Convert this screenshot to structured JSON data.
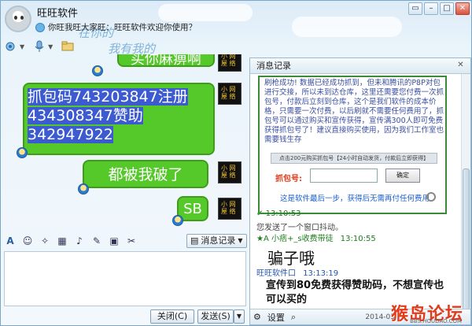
{
  "window": {
    "title": "旺旺软件",
    "status": "你旺我旺大家旺：旺旺软件欢迎你使用？",
    "decor_text": [
      "在你的",
      "我有我的"
    ]
  },
  "window_buttons": [
    "▭",
    "–",
    "□",
    "✕"
  ],
  "chat": {
    "messages": [
      {
        "text": "买你麻痹啊"
      },
      {
        "text": "抓包码743203847注册434308347赞助342947922"
      },
      {
        "text": "都被我破了"
      },
      {
        "text": "SB"
      }
    ],
    "sender_icon_label": "小 网 屋 络"
  },
  "input_toolbar": {
    "history_label": "消息记录"
  },
  "buttons": {
    "close_label": "关闭(C)",
    "send_label": "发送(S)"
  },
  "panel": {
    "title": "消息记录",
    "ad_text": "刷枪成功! 数据已经成功抓到，但未和腾讯的P8P对包进行交接，所以未到达仓库，这里还需要您付费一次抓包号，付款后立刻到仓库，这个是我们软件的成本价格，只需要一次付费，以后刷就不需要任何费用了，抓包号可以通过购买和宣传获得，宣传满300人即可免费获得抓包号了！建议直接购买使用，因为我们工作室也需要钱生存",
    "ad_bar_text": "点击200元购买抓包号【24小时自动发货，付款后立即获得】",
    "ad_label": "抓包号:",
    "ad_ok": "确定",
    "ad_foot": "这是软件最后一步，获得后无需再付任何费用",
    "entries": [
      {
        "time": "13:10:53",
        "text": "您发送了一个窗口抖动。"
      },
      {
        "name": "★A 小痞+_s收费带徒",
        "time": "13:10:55",
        "text": "骗子哦"
      },
      {
        "name": "旺旺软件口",
        "time": "13:13:19",
        "text": "宣传到80免费获得赞助码，不想宣传也可以买的"
      }
    ],
    "foot_label": "设置",
    "foot_date": "2014-03"
  },
  "watermark": {
    "title": "猴岛论坛",
    "sub": "BBS.HOUDAO.COM"
  }
}
